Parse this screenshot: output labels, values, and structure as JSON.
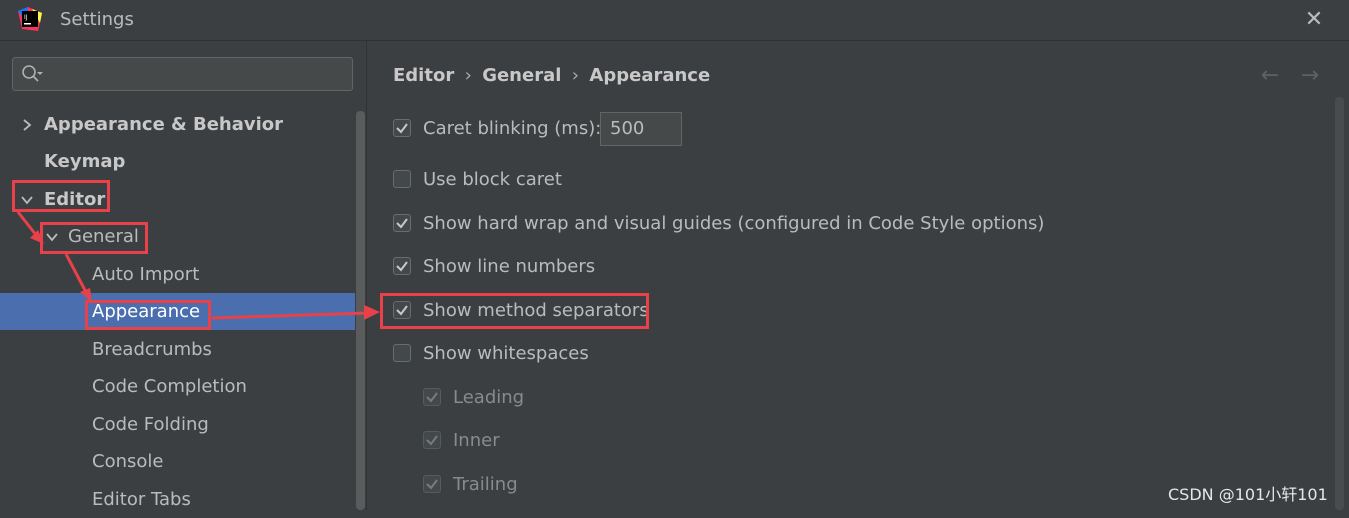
{
  "window": {
    "title": "Settings",
    "close_label": "✕"
  },
  "search": {
    "value": "",
    "placeholder": ""
  },
  "sidebar": {
    "items": [
      {
        "label": "Appearance & Behavior"
      },
      {
        "label": "Keymap"
      },
      {
        "label": "Editor"
      },
      {
        "label": "General"
      },
      {
        "label": "Auto Import"
      },
      {
        "label": "Appearance"
      },
      {
        "label": "Breadcrumbs"
      },
      {
        "label": "Code Completion"
      },
      {
        "label": "Code Folding"
      },
      {
        "label": "Console"
      },
      {
        "label": "Editor Tabs"
      }
    ]
  },
  "breadcrumb": {
    "part1": "Editor",
    "part2": "General",
    "part3": "Appearance",
    "sep": "›"
  },
  "nav": {
    "back": "←",
    "forward": "→"
  },
  "options": {
    "caret_blinking": {
      "label": "Caret blinking (ms):",
      "value": "500",
      "checked": true
    },
    "block_caret": {
      "label": "Use block caret",
      "checked": false
    },
    "hard_wrap": {
      "label": "Show hard wrap and visual guides (configured in Code Style options)",
      "checked": true
    },
    "line_numbers": {
      "label": "Show line numbers",
      "checked": true
    },
    "method_separators": {
      "label": "Show method separators",
      "checked": true
    },
    "whitespaces": {
      "label": "Show whitespaces",
      "checked": false
    },
    "leading": {
      "label": "Leading",
      "checked": true
    },
    "inner": {
      "label": "Inner",
      "checked": true
    },
    "trailing": {
      "label": "Trailing",
      "checked": true
    }
  },
  "watermark": "CSDN @101小轩101",
  "colors": {
    "selection": "#4b6eaf",
    "annotation": "#e8414a",
    "background": "#3c3f41"
  }
}
